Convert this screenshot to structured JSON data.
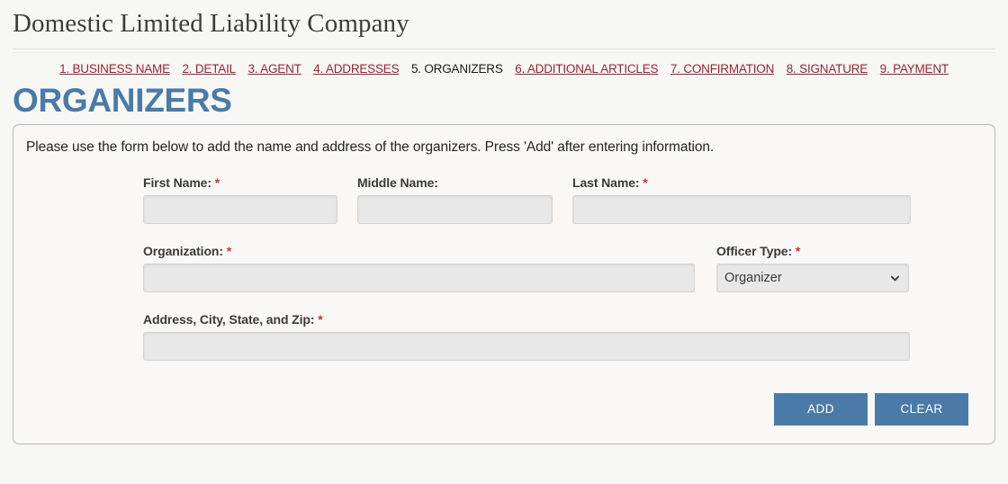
{
  "header": {
    "title": "Domestic Limited Liability Company"
  },
  "steps": [
    {
      "label": "1. BUSINESS NAME",
      "current": false
    },
    {
      "label": "2. DETAIL",
      "current": false
    },
    {
      "label": "3. AGENT",
      "current": false
    },
    {
      "label": "4. ADDRESSES",
      "current": false
    },
    {
      "label": "5. ORGANIZERS",
      "current": true
    },
    {
      "label": "6. ADDITIONAL ARTICLES",
      "current": false
    },
    {
      "label": "7. CONFIRMATION",
      "current": false
    },
    {
      "label": "8. SIGNATURE",
      "current": false
    },
    {
      "label": "9. PAYMENT",
      "current": false
    }
  ],
  "section": {
    "heading": "ORGANIZERS",
    "intro": "Please use the form below to add the name and address of the organizers. Press 'Add' after entering information."
  },
  "form": {
    "first_name": {
      "label": "First Name:",
      "required": "*",
      "value": ""
    },
    "middle_name": {
      "label": "Middle Name:",
      "required": "",
      "value": ""
    },
    "last_name": {
      "label": "Last Name:",
      "required": "*",
      "value": ""
    },
    "organization": {
      "label": "Organization:",
      "required": "*",
      "value": ""
    },
    "officer_type": {
      "label": "Officer Type:",
      "required": "*",
      "value": "Organizer",
      "options": [
        "Organizer"
      ]
    },
    "address": {
      "label": "Address, City, State, and Zip:",
      "required": "*",
      "value": ""
    }
  },
  "buttons": {
    "add": "ADD",
    "clear": "CLEAR"
  },
  "colors": {
    "accent": "#4a7ba8",
    "link": "#9b2335",
    "required": "#d32f2f",
    "page_bg": "#f7f7f4",
    "input_bg": "#e8e8e8"
  }
}
